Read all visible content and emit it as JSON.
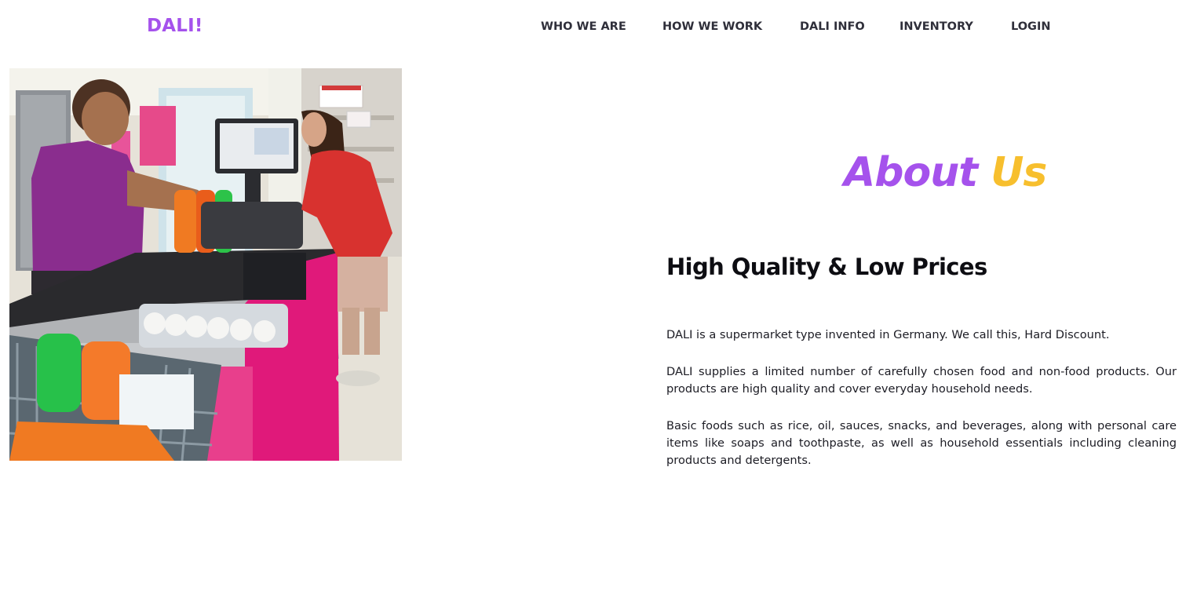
{
  "nav": {
    "brand": "DALI!",
    "items": [
      {
        "label": "WHO WE ARE"
      },
      {
        "label": "HOW WE WORK"
      },
      {
        "label": "DALI INFO"
      },
      {
        "label": "INVENTORY"
      },
      {
        "label": "LOGIN"
      }
    ]
  },
  "about": {
    "title_part1": "About",
    "title_part2": "Us",
    "subtitle": "High Quality & Low Prices",
    "paragraphs": [
      "DALI is a supermarket type invented in Germany. We call this, Hard Discount.",
      "DALI supplies a limited number of carefully chosen food and non-food products. Our products are high quality and cover everyday household needs.",
      "Basic foods such as rice, oil, sauces, snacks, and beverages, along with personal care items like soaps and toothpaste, as well as household essentials including cleaning products and detergents."
    ]
  },
  "colors": {
    "brand_purple": "#a552ec",
    "accent_yellow": "#f7bf2e",
    "nav_text": "#2f2f3a"
  }
}
